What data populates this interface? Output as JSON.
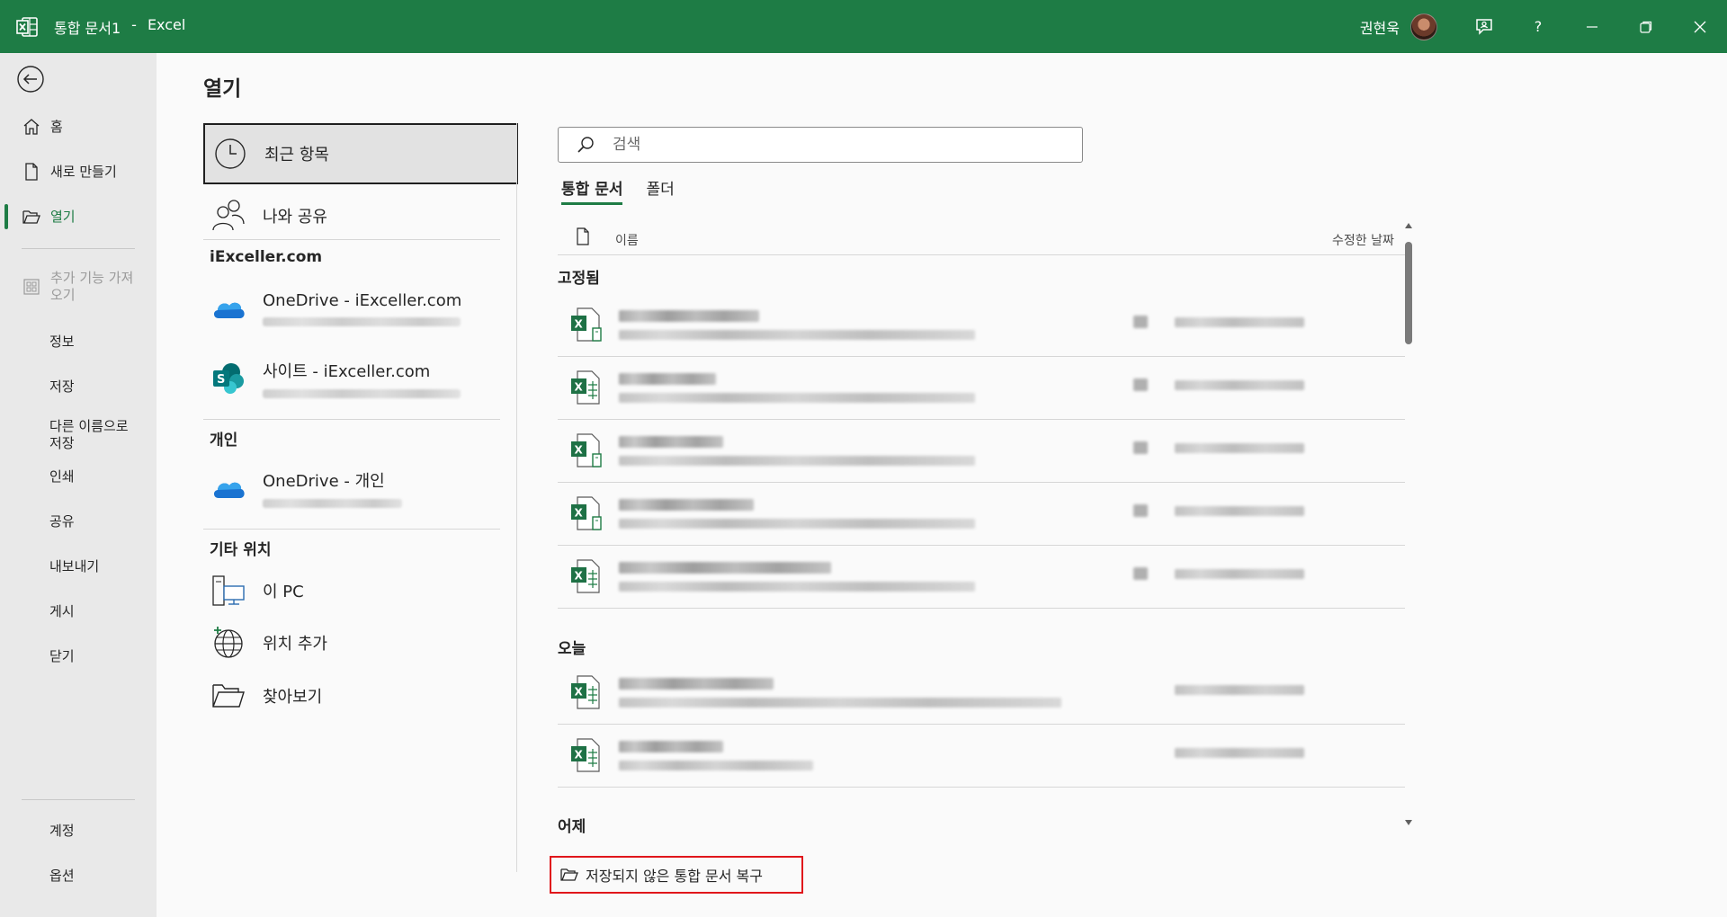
{
  "window": {
    "doc_title": "통합 문서1",
    "separator": "-",
    "app_name": "Excel",
    "user_name": "권현욱",
    "help_label": "?"
  },
  "nav": {
    "home": "홈",
    "new": "새로 만들기",
    "open": "열기",
    "addins": "추가 기능 가져오기",
    "info": "정보",
    "save": "저장",
    "save_as": "다른 이름으로 저장",
    "print": "인쇄",
    "share": "공유",
    "export": "내보내기",
    "publish": "게시",
    "close": "닫기",
    "account": "계정",
    "options": "옵션"
  },
  "page": {
    "title": "열기"
  },
  "locations": {
    "recent": "최근 항목",
    "shared": "나와 공유",
    "org_heading": "iExceller.com",
    "onedrive_org": "OneDrive - iExceller.com",
    "sites": "사이트 - iExceller.com",
    "personal_heading": "개인",
    "onedrive_personal": "OneDrive - 개인",
    "other_heading": "기타 위치",
    "this_pc": "이 PC",
    "add_place": "위치 추가",
    "browse": "찾아보기"
  },
  "search": {
    "placeholder": "검색"
  },
  "tabs": {
    "workbooks": "통합 문서",
    "folders": "폴더"
  },
  "list": {
    "col_name": "이름",
    "col_date": "수정한 날짜",
    "group_pinned": "고정됨",
    "group_today": "오늘",
    "group_yesterday": "어제"
  },
  "recover": {
    "label": "저장되지 않은 통합 문서 복구"
  },
  "colors": {
    "accent": "#1e7c45",
    "highlight_border": "#e0161b"
  }
}
